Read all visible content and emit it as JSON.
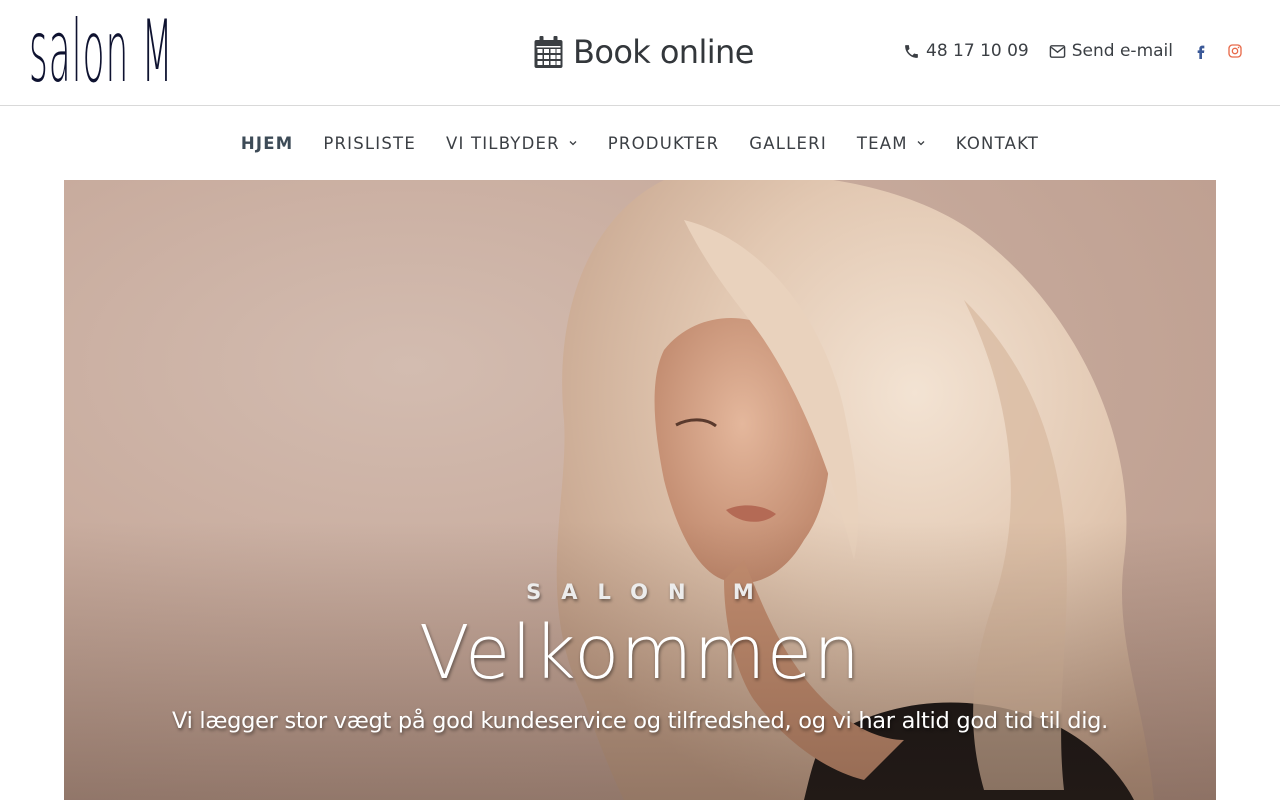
{
  "header": {
    "logo_text": "salon M",
    "book_label": "Book online",
    "phone": "48 17 10 09",
    "email_label": "Send e-mail"
  },
  "icons": {
    "calendar": "calendar-icon",
    "phone": "phone-icon",
    "email": "envelope-icon",
    "facebook": "facebook-icon",
    "instagram": "instagram-icon",
    "chevron": "chevron-down-icon"
  },
  "colors": {
    "logo": "#0e1230",
    "text": "#3b3f44",
    "facebook": "#3b5998",
    "instagram": "#e86a4a",
    "hero_bg": "#c7aa9c"
  },
  "nav": {
    "items": [
      {
        "label": "HJEM",
        "active": true,
        "dropdown": false
      },
      {
        "label": "PRISLISTE",
        "active": false,
        "dropdown": false
      },
      {
        "label": "VI TILBYDER",
        "active": false,
        "dropdown": true
      },
      {
        "label": "PRODUKTER",
        "active": false,
        "dropdown": false
      },
      {
        "label": "GALLERI",
        "active": false,
        "dropdown": false
      },
      {
        "label": "TEAM",
        "active": false,
        "dropdown": true
      },
      {
        "label": "KONTAKT",
        "active": false,
        "dropdown": false
      }
    ]
  },
  "hero": {
    "kicker": "SALON M",
    "title": "Velkommen",
    "subtitle": "Vi lægger stor vægt på god kundeservice og tilfredshed, og vi har altid god tid til dig."
  }
}
